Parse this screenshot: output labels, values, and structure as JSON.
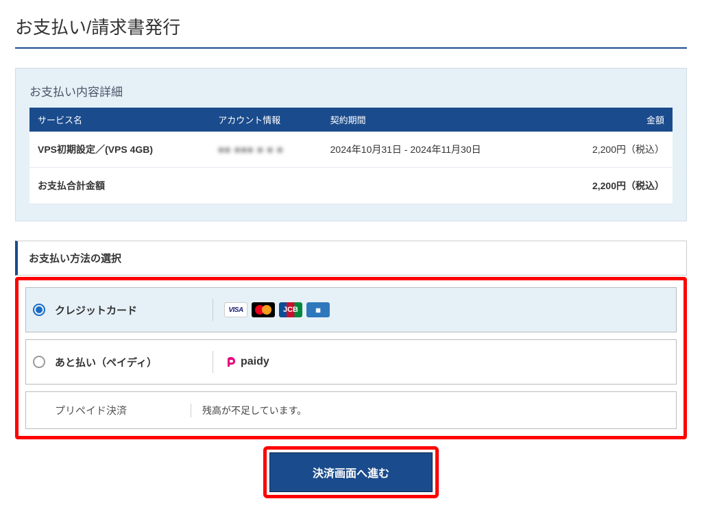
{
  "page": {
    "title": "お支払い/請求書発行"
  },
  "details": {
    "heading": "お支払い内容詳細",
    "columns": {
      "service": "サービス名",
      "account": "アカウント情報",
      "period": "契約期間",
      "amount": "金額"
    },
    "rows": [
      {
        "service": "VPS初期設定／(VPS 4GB)",
        "account": "■■ ■■■ ■ ■ ■",
        "period": "2024年10月31日 - 2024年11月30日",
        "amount": "2,200円（税込）"
      }
    ],
    "total": {
      "label": "お支払合計金額",
      "amount": "2,200円（税込）"
    }
  },
  "methods": {
    "heading": "お支払い方法の選択",
    "options": {
      "credit": {
        "label": "クレジットカード",
        "selected": true
      },
      "paidy": {
        "label": "あと払い（ペイディ）",
        "brand": "paidy",
        "selected": false
      },
      "prepaid": {
        "label": "プリペイド決済",
        "note": "残高が不足しています。"
      }
    }
  },
  "submit": {
    "label": "決済画面へ進む"
  }
}
